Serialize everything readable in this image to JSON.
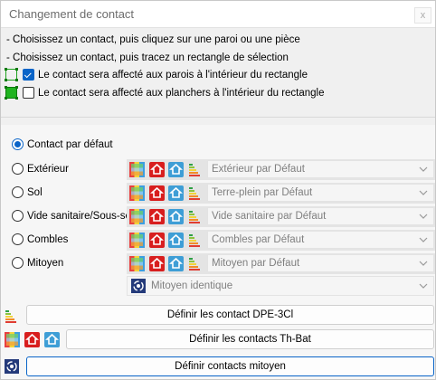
{
  "window": {
    "title": "Changement de contact",
    "close": "x"
  },
  "instructions": [
    "- Choisissez un contact, puis cliquez sur une paroi ou une pièce",
    "- Choisissez un contact, puis tracez un rectangle de sélection"
  ],
  "options": {
    "walls_label": "Le contact sera affecté aux parois à l'intérieur du rectangle",
    "walls_checked": true,
    "floors_label": "Le contact sera affecté aux planchers à l'intérieur du rectangle",
    "floors_checked": false
  },
  "contacts": {
    "default_label": "Contact par défaut",
    "rows": [
      {
        "label": "Extérieur",
        "value": "Extérieur par Défaut"
      },
      {
        "label": "Sol",
        "value": "Terre-plein par Défaut"
      },
      {
        "label": "Vide sanitaire/Sous-sol",
        "value": "Vide sanitaire par Défaut"
      },
      {
        "label": "Combles",
        "value": "Combles par Défaut"
      },
      {
        "label": "Mitoyen",
        "value": "Mitoyen par Défaut"
      }
    ],
    "mitoyen_mode": "Mitoyen identique"
  },
  "buttons": {
    "dpe": "Définir les contact DPE-3Cl",
    "thbat": "Définir les contacts Th-Bat",
    "mitoyen": "Définir contacts mitoyen"
  }
}
